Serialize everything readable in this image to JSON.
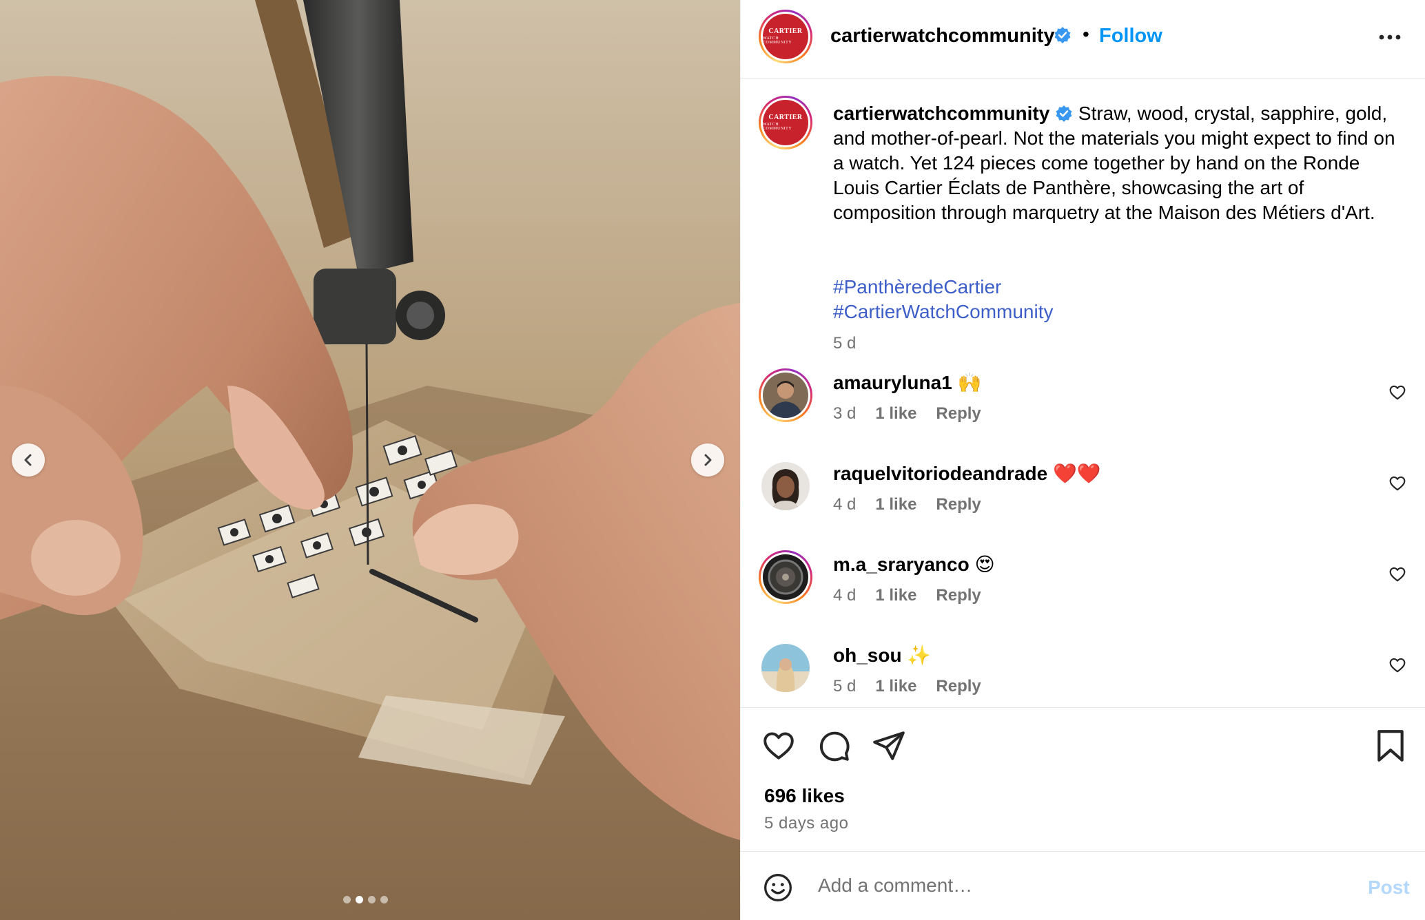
{
  "post": {
    "media": {
      "description_icon": "photo",
      "carousel": {
        "total": 4,
        "active_index": 1
      },
      "prev_icon": "chevron-left-icon",
      "next_icon": "chevron-right-icon"
    },
    "header": {
      "avatar_text_1": "CARTIER",
      "avatar_text_2": "WATCH COMMUNITY",
      "username": "cartierwatchcommunity",
      "verified": true,
      "separator": "•",
      "follow_label": "Follow",
      "more_icon": "more-horizontal-icon"
    },
    "caption": {
      "username": "cartierwatchcommunity",
      "text": "Straw, wood, crystal, sapphire, gold, and mother-of-pearl. Not the materials you might expect to find on a watch. Yet 124 pieces come together by hand on the Ronde Louis Cartier Éclats de Panthère, showcasing the art of composition through marquetry at the Maison des Métiers d'Art.",
      "hashtags": [
        "#PanthèredeCartier",
        "#CartierWatchCommunity"
      ],
      "time": "5 d"
    },
    "comments": [
      {
        "username": "amauryluna1",
        "text": "🙌",
        "time": "3 d",
        "likes": "1 like",
        "reply": "Reply"
      },
      {
        "username": "raquelvitoriodeandrade",
        "text": "❤️❤️",
        "time": "4 d",
        "likes": "1 like",
        "reply": "Reply"
      },
      {
        "username": "m.a_sraryanco",
        "text": "😍",
        "time": "4 d",
        "likes": "1 like",
        "reply": "Reply"
      },
      {
        "username": "oh_sou",
        "text": "✨",
        "time": "5 d",
        "likes": "1 like",
        "reply": "Reply"
      }
    ],
    "actions": {
      "like_icon": "heart-icon",
      "comment_icon": "comment-icon",
      "share_icon": "send-icon",
      "save_icon": "bookmark-icon"
    },
    "likes": "696 likes",
    "posted": "5 days ago",
    "composer": {
      "placeholder": "Add a comment…",
      "post_label": "Post",
      "emoji_icon": "emoji-icon"
    },
    "colors": {
      "link_blue": "#0095f6",
      "hashtag_blue": "#3d5ec8",
      "muted": "#737373",
      "brand_red": "#c8232c",
      "post_disabled": "#b3d8fb"
    }
  }
}
